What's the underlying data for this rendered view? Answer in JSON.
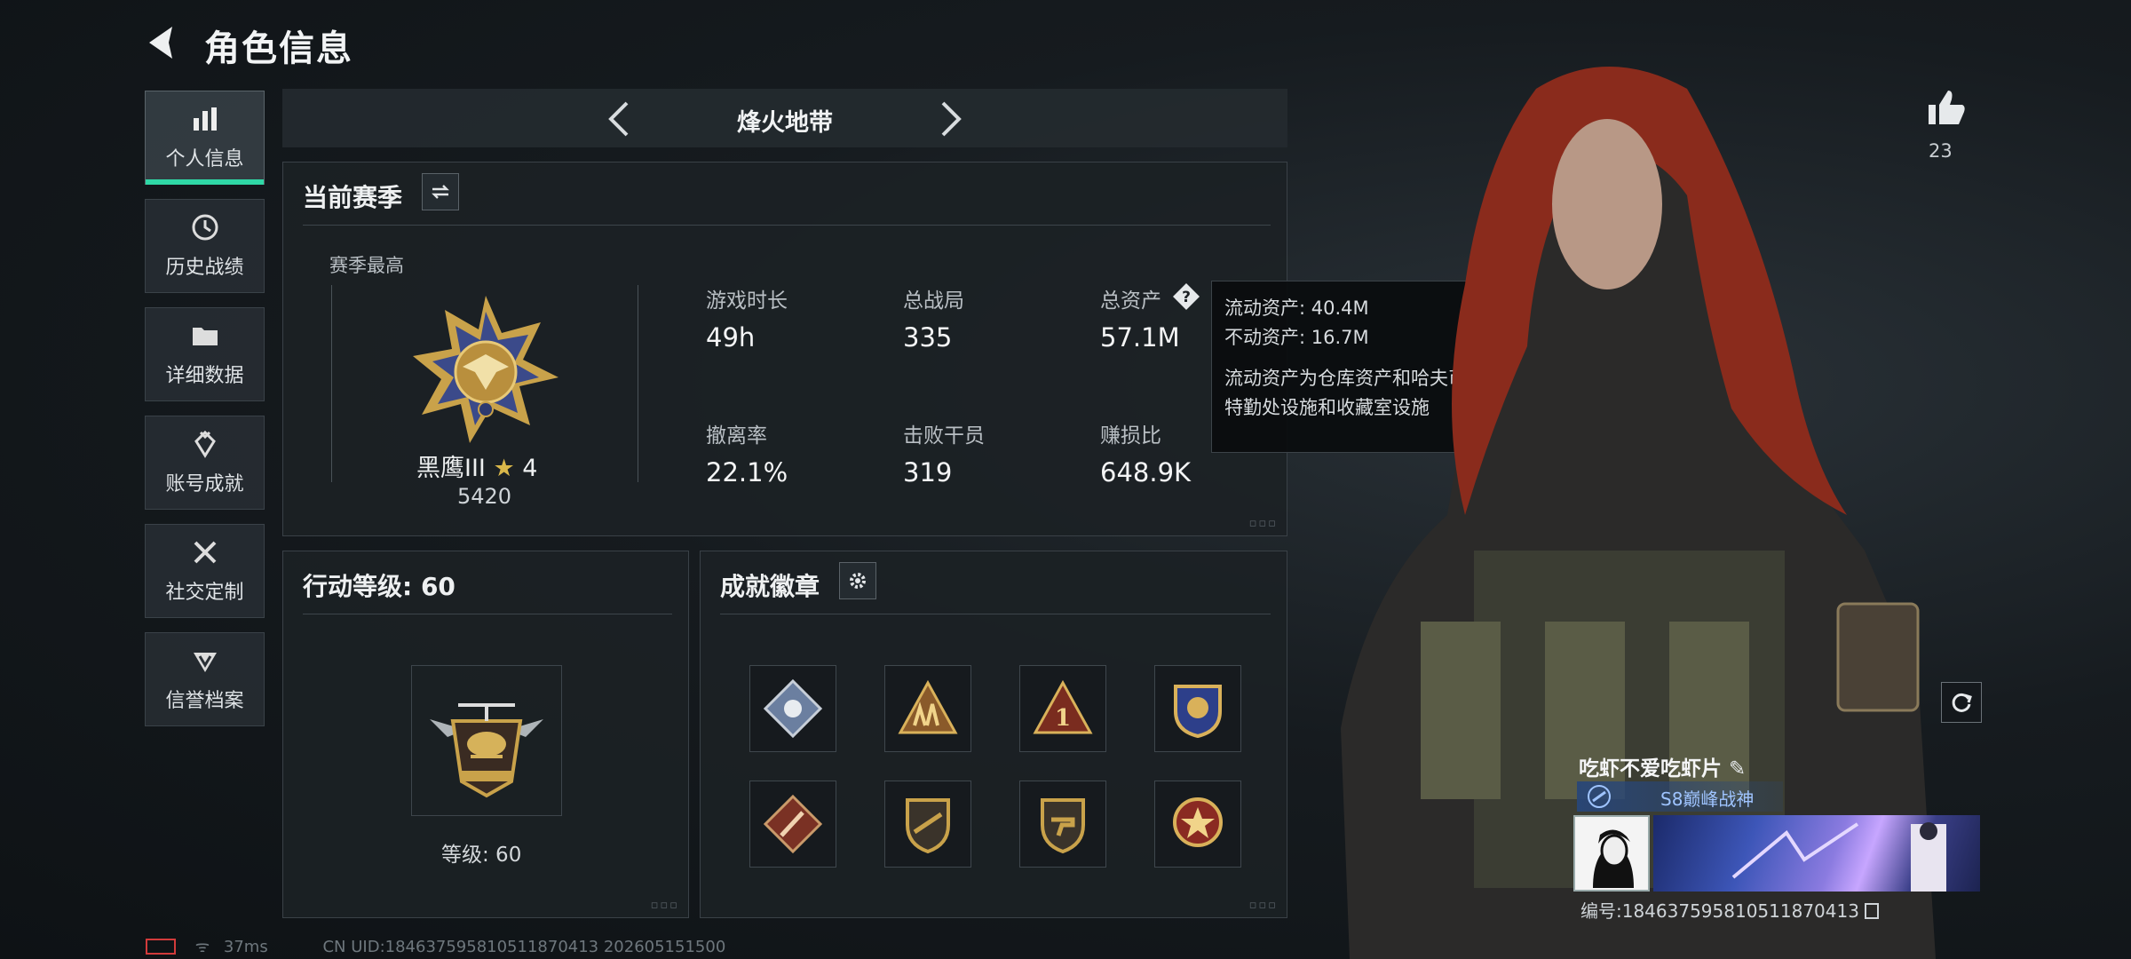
{
  "header": {
    "title": "角色信息"
  },
  "sidebar": {
    "items": [
      {
        "label": "个人信息",
        "icon": "bar-chart-icon",
        "active": true
      },
      {
        "label": "历史战绩",
        "icon": "clock-icon",
        "active": false
      },
      {
        "label": "详细数据",
        "icon": "folder-icon",
        "active": false
      },
      {
        "label": "账号成就",
        "icon": "achievement-icon",
        "active": false
      },
      {
        "label": "社交定制",
        "icon": "tools-icon",
        "active": false
      },
      {
        "label": "信誉档案",
        "icon": "credit-icon",
        "active": false
      }
    ]
  },
  "mode": {
    "title": "烽火地带"
  },
  "season": {
    "title": "当前赛季",
    "best_label": "赛季最高",
    "rank_name": "黑鹰III",
    "rank_stars": "4",
    "rank_score": "5420",
    "stats": [
      {
        "label": "游戏时长",
        "value": "49h"
      },
      {
        "label": "总战局",
        "value": "335"
      },
      {
        "label": "总资产",
        "value": "57.1M"
      },
      {
        "label": "撤离率",
        "value": "22.1%"
      },
      {
        "label": "击败干员",
        "value": "319"
      },
      {
        "label": "赚损比",
        "value": "648.9K"
      }
    ]
  },
  "tooltip": {
    "line1": "流动资产: 40.4M",
    "line2": "不动资产: 16.7M",
    "line3": "流动资产为仓库资产和哈夫币，不动资产为",
    "line4": "特勤处设施和收藏室设施"
  },
  "level": {
    "title": "行动等级: 60",
    "caption": "等级: 60"
  },
  "badges": {
    "title": "成就徽章",
    "items": [
      "diamond-badge-icon",
      "soldiers-badge-icon",
      "first-place-badge-icon",
      "crest-badge-icon",
      "wrench-badge-icon",
      "rifle-shield-badge-icon",
      "pistol-shield-badge-icon",
      "star-medal-badge-icon"
    ]
  },
  "profile": {
    "likes": "23",
    "name": "吃虾不爱吃虾片",
    "title": "S8巅峰战神",
    "uid_line": "编号:1846375958105118704​13"
  },
  "status": {
    "ping": "37ms",
    "uid": "CN UID:18463759581051187041​3 20260515150​0"
  },
  "colors": {
    "accent": "#2fd8a6",
    "panel": "#1c2125",
    "gold": "#c9a24a"
  }
}
